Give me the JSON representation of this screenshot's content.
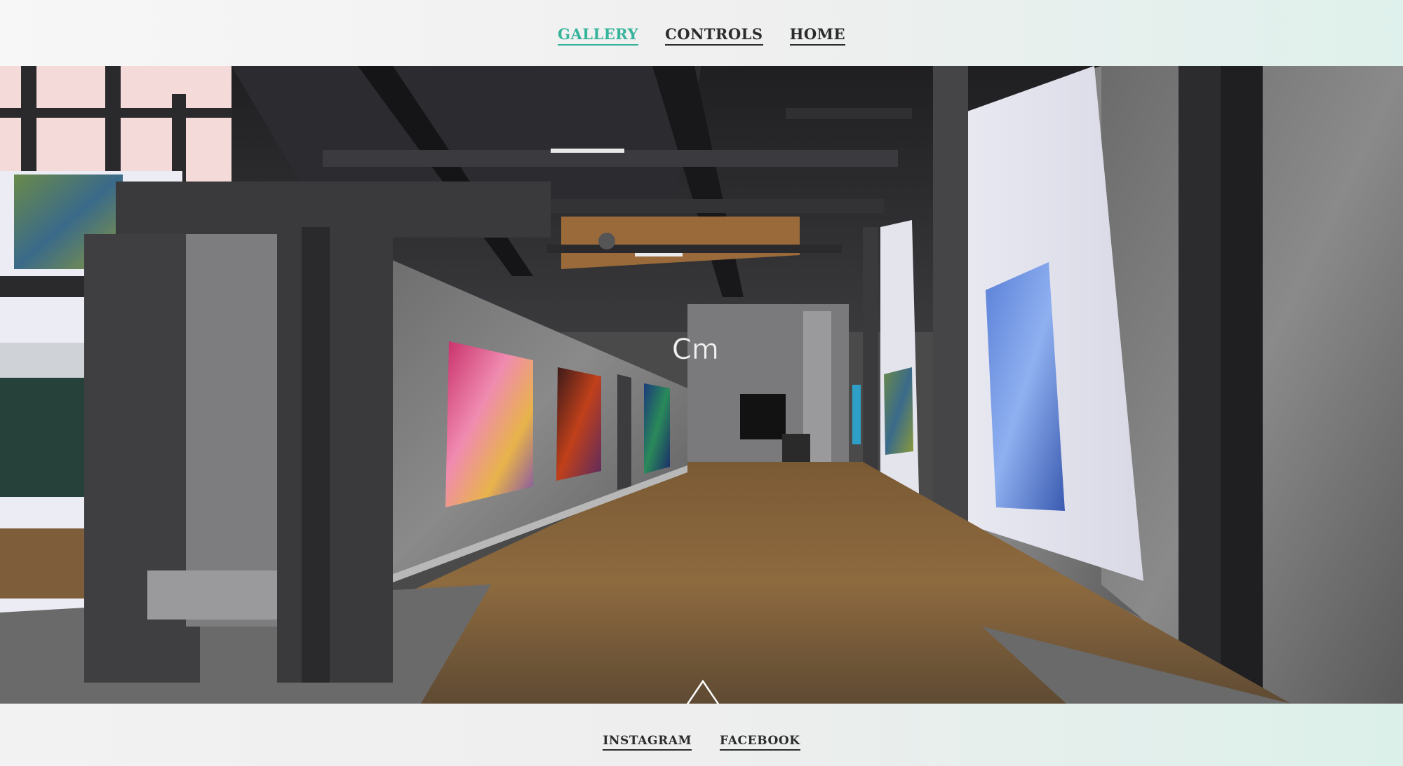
{
  "nav": {
    "items": [
      {
        "label": "GALLERY",
        "active": true
      },
      {
        "label": "CONTROLS",
        "active": false
      },
      {
        "label": "HOME",
        "active": false
      }
    ]
  },
  "viewport": {
    "description_icon": "3d-gallery-scene",
    "logo_text": "Cm"
  },
  "controls": {
    "icons": [
      "arrow-up-icon",
      "arrow-down-icon",
      "arrow-left-icon",
      "arrow-right-icon"
    ]
  },
  "footer": {
    "instagram_label": "INSTAGRAM",
    "facebook_label": "FACEBOOK"
  },
  "colors": {
    "accent": "#35b39b",
    "text": "#2b2b2b"
  }
}
